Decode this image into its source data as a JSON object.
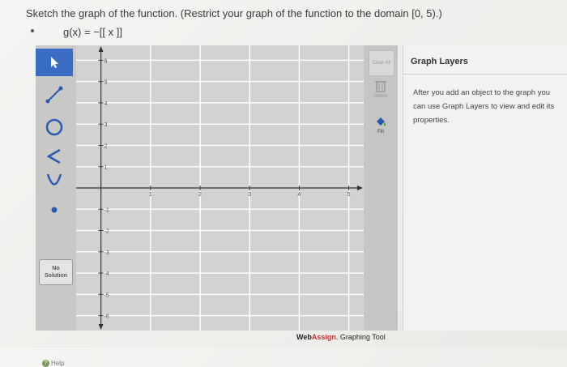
{
  "question": {
    "prompt": "Sketch the graph of the function. (Restrict your graph of the function to the domain [0, 5).)",
    "function": "g(x) = −[[ x ]]"
  },
  "tools": [
    {
      "name": "pointer",
      "icon": "arrow-pointer-icon",
      "active": true
    },
    {
      "name": "line",
      "icon": "line-segment-icon"
    },
    {
      "name": "circle",
      "icon": "circle-icon"
    },
    {
      "name": "angle",
      "icon": "angle-icon"
    },
    {
      "name": "parabola",
      "icon": "parabola-icon"
    },
    {
      "name": "point",
      "icon": "point-icon"
    }
  ],
  "no_solution": {
    "line1": "No",
    "line2": "Solution"
  },
  "help_label": "Help",
  "graph": {
    "x_tick_labels": [
      "1",
      "2",
      "3",
      "4",
      "5"
    ],
    "y_tick_labels_pos": [
      "1",
      "2",
      "3",
      "4",
      "5",
      "6"
    ],
    "y_tick_labels_neg": [
      "-1",
      "-2",
      "-3",
      "-4",
      "-5",
      "-6"
    ],
    "xlim": [
      -0.5,
      5.3
    ],
    "ylim": [
      -6.7,
      6.7
    ]
  },
  "right_tools": {
    "clear_all": "Clear All",
    "delete": "Delete",
    "fill": "Fill"
  },
  "brand": {
    "web": "Web",
    "assign": "Assign",
    "suffix": ". Graphing Tool"
  },
  "layers": {
    "title": "Graph Layers",
    "text_line1": "After you add an object to the graph you",
    "text_line2": "can use Graph Layers to view and edit its",
    "text_line3": "properties."
  },
  "colors": {
    "active_tool": "#3a6cc4",
    "brand_assign": "#cc3333",
    "grid_line": "#ffffff",
    "axis": "#333333"
  }
}
